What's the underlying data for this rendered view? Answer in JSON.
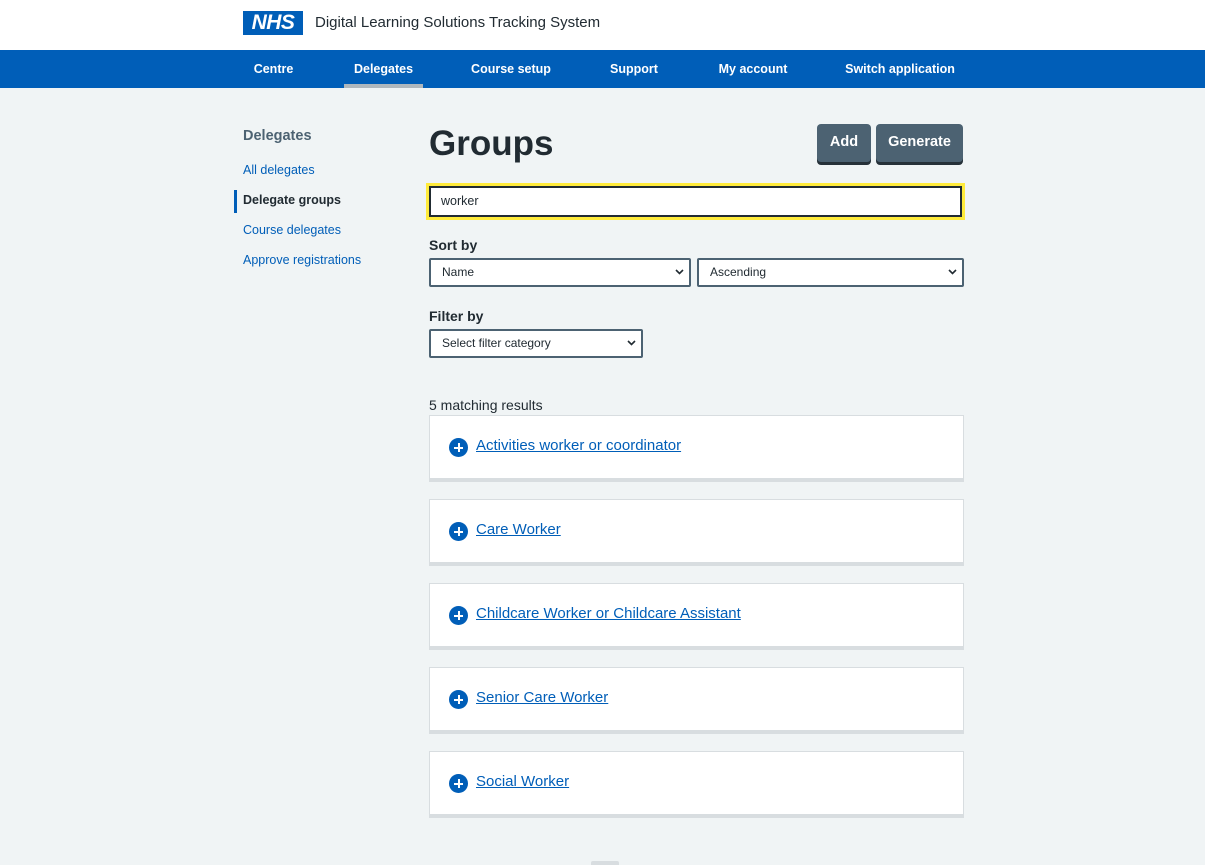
{
  "header": {
    "logo_text": "NHS",
    "app_title": "Digital Learning Solutions Tracking System"
  },
  "nav": {
    "items": [
      {
        "label": "Centre"
      },
      {
        "label": "Delegates",
        "active": true
      },
      {
        "label": "Course setup"
      },
      {
        "label": "Support"
      },
      {
        "label": "My account"
      },
      {
        "label": "Switch application"
      }
    ]
  },
  "sidebar": {
    "title": "Delegates",
    "items": [
      {
        "label": "All delegates"
      },
      {
        "label": "Delegate groups",
        "current": true
      },
      {
        "label": "Course delegates"
      },
      {
        "label": "Approve registrations"
      }
    ]
  },
  "main": {
    "title": "Groups",
    "add_label": "Add",
    "generate_label": "Generate",
    "search_value": "worker",
    "sort_label": "Sort by",
    "sort_field_value": "Name",
    "sort_direction_value": "Ascending",
    "filter_label": "Filter by",
    "filter_value": "Select filter category",
    "results_count": "5 matching results",
    "results": [
      {
        "label": "Activities worker or coordinator"
      },
      {
        "label": "Care Worker"
      },
      {
        "label": "Childcare Worker or Childcare Assistant"
      },
      {
        "label": "Senior Care Worker"
      },
      {
        "label": "Social Worker"
      }
    ]
  },
  "colors": {
    "brand_blue": "#005eb8",
    "button_grey": "#4c6272",
    "focus_yellow": "#ffeb3b",
    "page_background": "#f0f4f5"
  }
}
